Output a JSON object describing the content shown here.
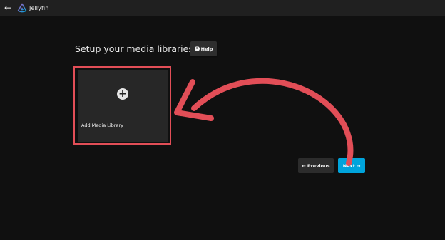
{
  "header": {
    "back_glyph": "←",
    "logo_icon": "jellyfin-logo-icon",
    "app_name": "Jellyfin"
  },
  "main": {
    "title": "Setup your media libraries",
    "help_label": "Help",
    "help_icon_glyph": "i",
    "add_library": {
      "icon_glyph": "+",
      "label": "Add Media Library"
    }
  },
  "footer": {
    "previous_glyph": "←",
    "previous_label": "Previous",
    "next_label": "Next",
    "next_glyph": "→"
  },
  "colors": {
    "accent": "#00a4dc",
    "annotation": "#e24e57",
    "background": "#101010"
  }
}
